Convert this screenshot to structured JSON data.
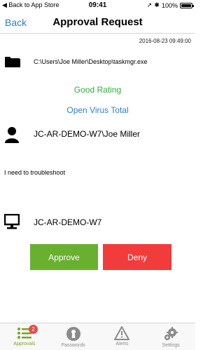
{
  "status_bar": {
    "back_label": "Back to App Store",
    "time": "09:41",
    "battery": "100%"
  },
  "nav": {
    "back_label": "Back",
    "title": "Approval Request"
  },
  "request": {
    "timestamp": "2016-08-23 09:49:00",
    "file_path": "C:\\Users\\Joe Miller\\Desktop\\taskmgr.exe",
    "rating": "Good Rating",
    "virus_total_link": "Open Virus Total",
    "user": "JC-AR-DEMO-W7\\Joe Miller",
    "reason": "I need to troubleshoot",
    "computer": "JC-AR-DEMO-W7"
  },
  "actions": {
    "approve_label": "Approve",
    "deny_label": "Deny"
  },
  "tabs": [
    {
      "label": "Approvals",
      "icon": "list-icon",
      "badge": "2",
      "active": true
    },
    {
      "label": "Passwords",
      "icon": "keyhole-icon"
    },
    {
      "label": "Alerts",
      "icon": "warning-icon"
    },
    {
      "label": "Settings",
      "icon": "gear-icon"
    }
  ],
  "colors": {
    "accent_blue": "#2a7fd6",
    "good_green": "#2fae3a",
    "approve_green": "#69b02f",
    "deny_red": "#f23b3b",
    "active_tab": "#7aa32a",
    "badge_red": "#e84b4b"
  }
}
